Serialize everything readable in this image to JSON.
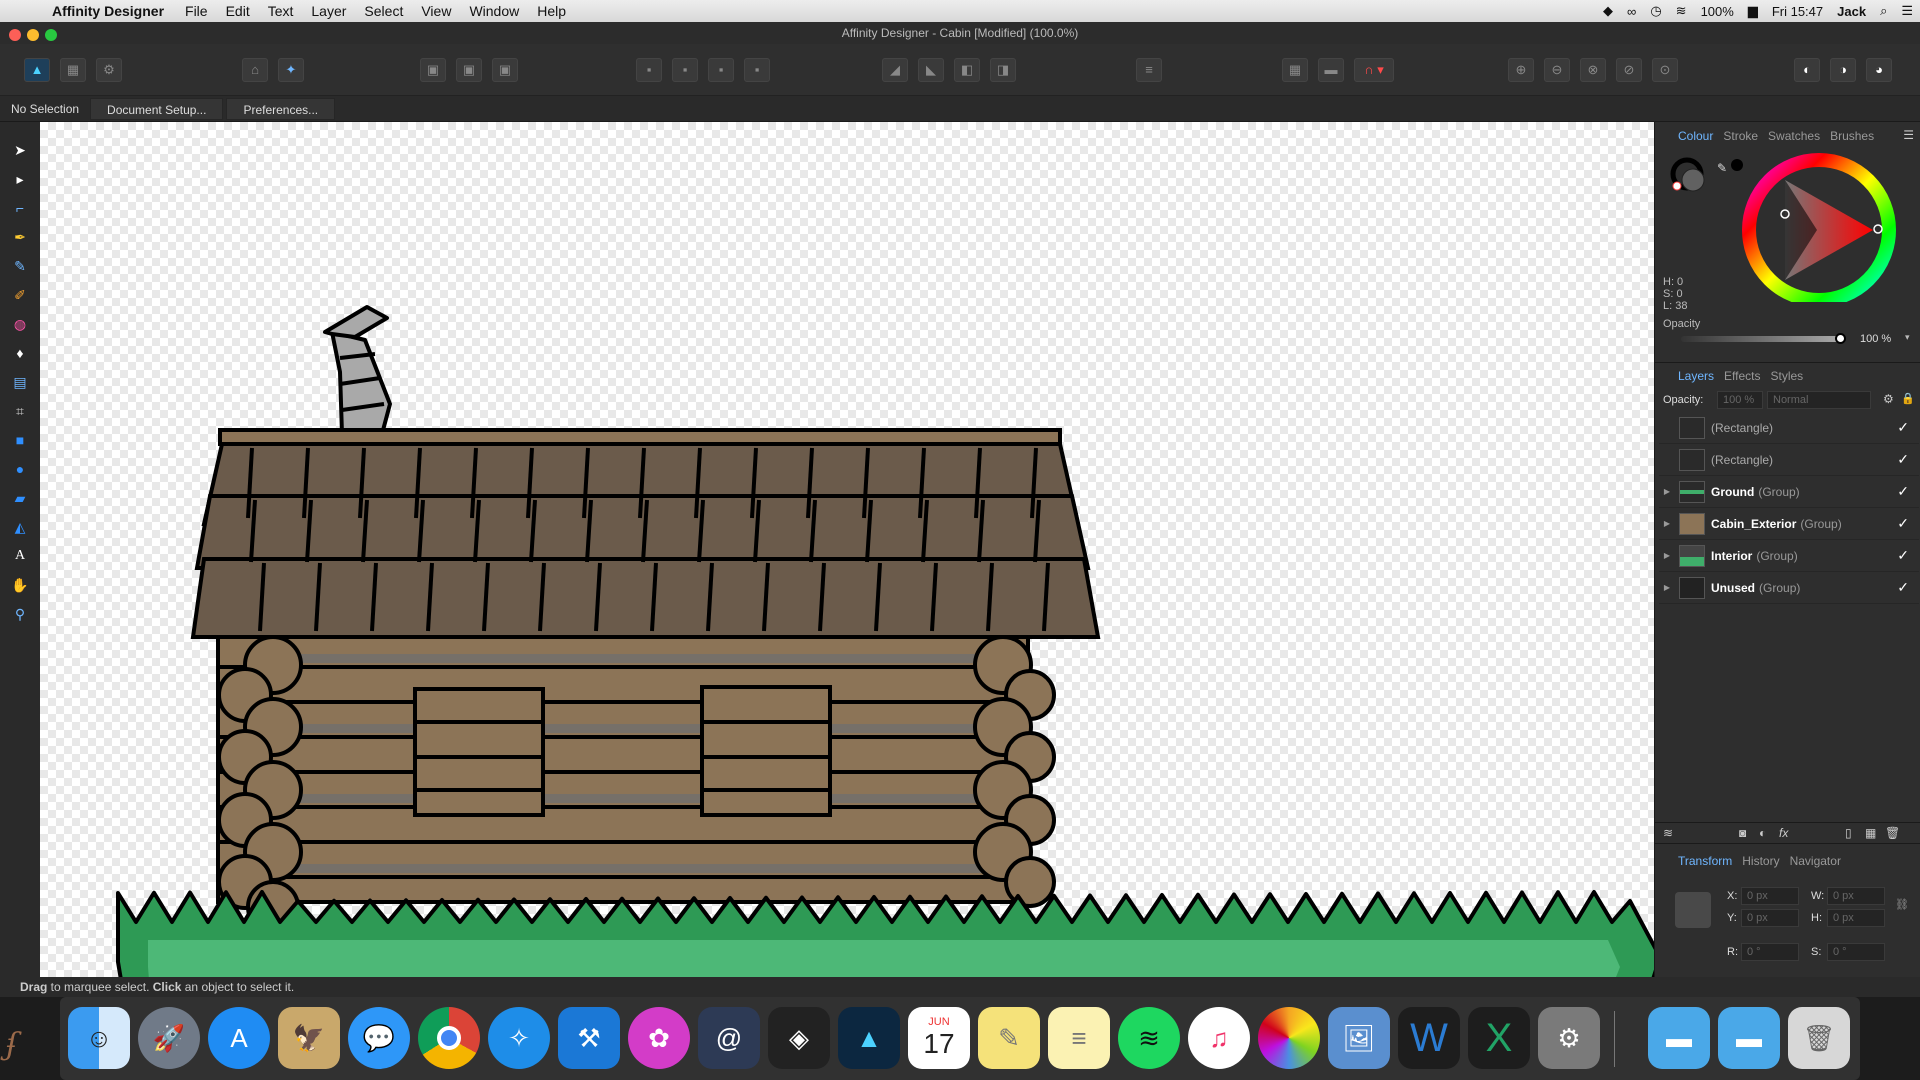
{
  "menubar": {
    "app_name": "Affinity Designer",
    "items": [
      "File",
      "Edit",
      "Text",
      "Layer",
      "Select",
      "View",
      "Window",
      "Help"
    ],
    "battery": "100%",
    "time": "Fri 15:47",
    "user": "Jack"
  },
  "window": {
    "title": "Affinity Designer - Cabin [Modified] (100.0%)"
  },
  "context": {
    "selection": "No Selection",
    "doc_setup": "Document Setup...",
    "preferences": "Preferences..."
  },
  "colour_panel": {
    "tabs": [
      "Colour",
      "Stroke",
      "Swatches",
      "Brushes"
    ],
    "h": "H: 0",
    "s": "S: 0",
    "l": "L: 38",
    "opacity_label": "Opacity",
    "opacity_value": "100 %",
    "opacity_level": 1.0
  },
  "layers_panel": {
    "tabs": [
      "Layers",
      "Effects",
      "Styles"
    ],
    "opacity_label": "Opacity:",
    "opacity_value": "100 %",
    "blend": "Normal",
    "layers": [
      {
        "name": "(Rectangle)",
        "type": "",
        "bold": false
      },
      {
        "name": "(Rectangle)",
        "type": "",
        "bold": false
      },
      {
        "name": "Ground",
        "type": "(Group)",
        "bold": true
      },
      {
        "name": "Cabin_Exterior",
        "type": "(Group)",
        "bold": true
      },
      {
        "name": "Interior",
        "type": "(Group)",
        "bold": true
      },
      {
        "name": "Unused",
        "type": "(Group)",
        "bold": true
      }
    ]
  },
  "transform_panel": {
    "tabs": [
      "Transform",
      "History",
      "Navigator"
    ],
    "x_label": "X:",
    "x": "0 px",
    "y_label": "Y:",
    "y": "0 px",
    "w_label": "W:",
    "w": "0 px",
    "h_label": "H:",
    "h": "0 px",
    "r_label": "R:",
    "r": "0 °",
    "s_label": "S:",
    "s": "0 °"
  },
  "status": {
    "drag": "Drag",
    "text1": " to marquee select. ",
    "click": "Click",
    "text2": " an object to select it."
  },
  "dock": {
    "calendar_month": "JUN",
    "calendar_day": "17"
  },
  "colors": {
    "accent": "#6fb6ff",
    "grass": "#3fae6a",
    "wood": "#8c7457"
  }
}
